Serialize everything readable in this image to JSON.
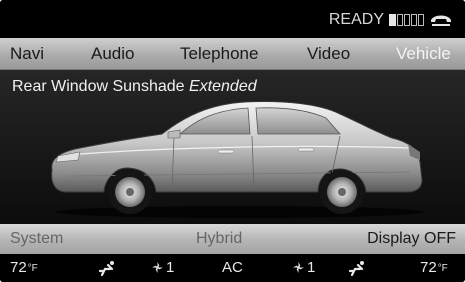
{
  "status": {
    "ready_label": "READY",
    "icons": [
      "signal-bars-icon",
      "phone-icon"
    ]
  },
  "menu": {
    "items": [
      {
        "label": "Navi"
      },
      {
        "label": "Audio"
      },
      {
        "label": "Telephone"
      },
      {
        "label": "Video"
      },
      {
        "label": "Vehicle",
        "active": true
      }
    ]
  },
  "main": {
    "title_prefix": "Rear Window Sunshade",
    "title_state": "Extended",
    "image": "car-side-view"
  },
  "infobar": {
    "system": "System",
    "hybrid": "Hybrid",
    "display_off": "Display OFF"
  },
  "climate": {
    "left_temp": "72",
    "left_unit": "°F",
    "left_fan": "1",
    "center": "AC",
    "right_fan": "1",
    "right_temp": "72",
    "right_unit": "°F"
  },
  "colors": {
    "background": "#000000",
    "menubar": "#b5b5b5",
    "active_tab": "#f3f3f3",
    "text": "#e8e8e8"
  }
}
